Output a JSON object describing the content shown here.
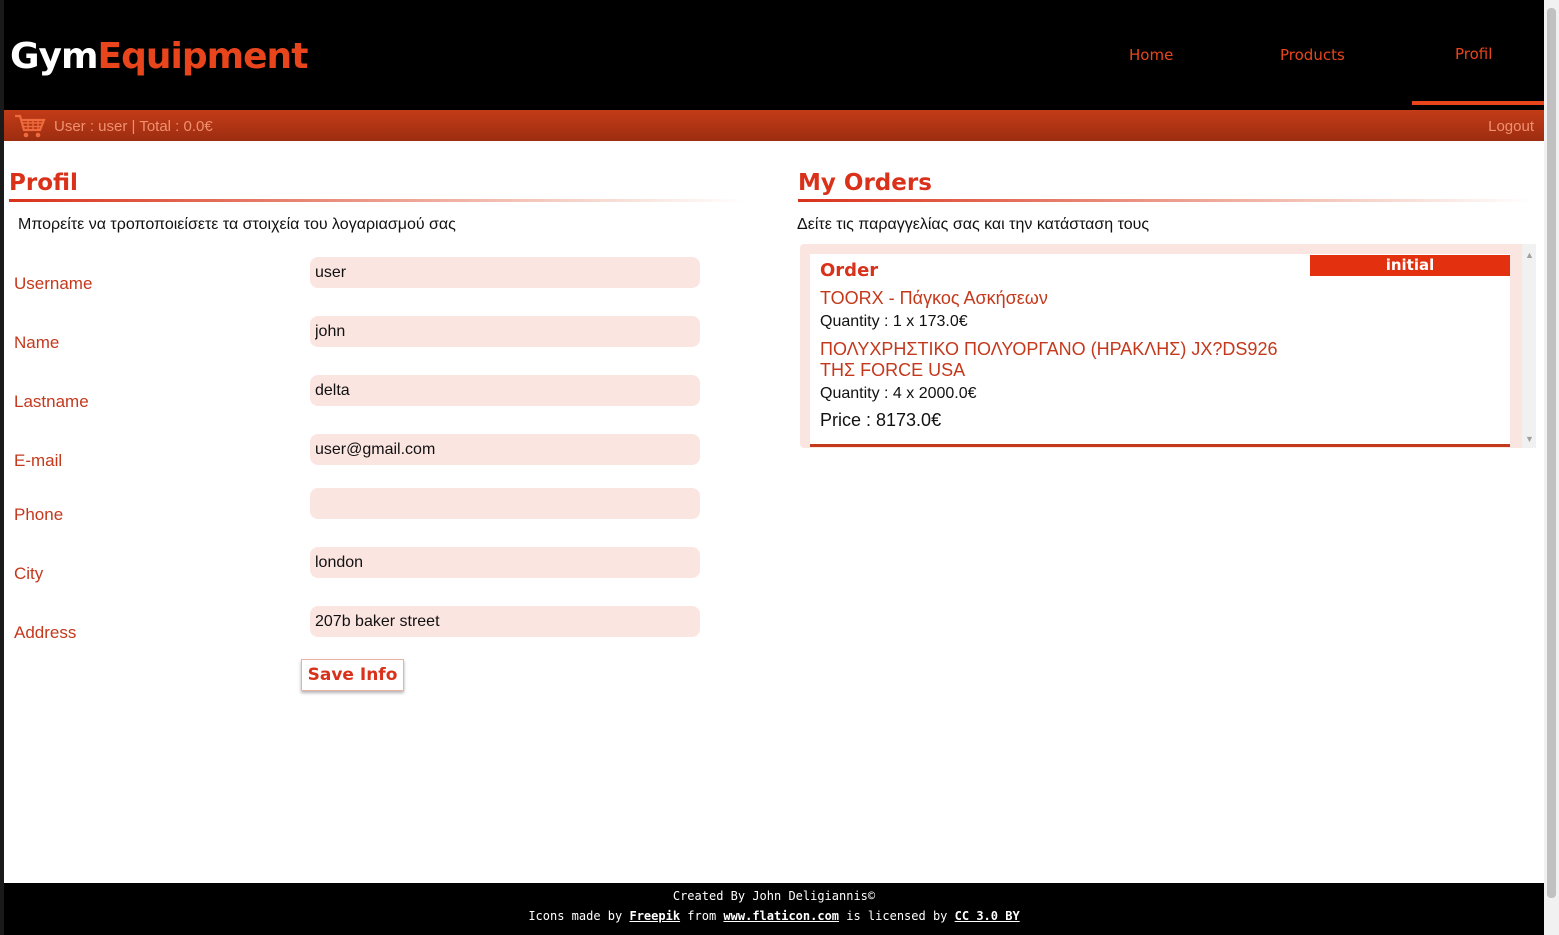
{
  "brand": {
    "part1": "Gym",
    "part2": "Equipment"
  },
  "nav": {
    "home": "Home",
    "products": "Products",
    "profil": "Profil"
  },
  "userbar": {
    "info": "User : user | Total : 0.0€",
    "logout": "Logout"
  },
  "profile": {
    "title": "Profil",
    "subtitle": "Μπορείτε να τροποποιείσετε τα στοιχεία του λογαριασμού σας",
    "fields": {
      "username": {
        "label": "Username",
        "value": "user"
      },
      "name": {
        "label": "Name",
        "value": "john"
      },
      "lastname": {
        "label": "Lastname",
        "value": "delta"
      },
      "email": {
        "label": "E-mail",
        "value": "user@gmail.com"
      },
      "phone": {
        "label": "Phone",
        "value": ""
      },
      "city": {
        "label": "City",
        "value": "london"
      },
      "address": {
        "label": "Address",
        "value": "207b baker street"
      }
    },
    "save_label": "Save Info"
  },
  "orders": {
    "title": "My Orders",
    "subtitle": "Δείτε τις παραγγελίας σας και την κατάσταση τους",
    "list": [
      {
        "title": "Order",
        "status": "initial",
        "items": [
          {
            "name": "TOORX - Πάγκος Ασκήσεων",
            "qty": "Quantity : 1 x 173.0€"
          },
          {
            "name": "ΠΟΛΥΧΡΗΣΤΙΚΟ ΠΟΛΥΟΡΓΑΝΟ (ΗΡΑΚΛΗΣ) JX?DS926 ΤΗΣ FORCE USA",
            "qty": "Quantity : 4 x 2000.0€"
          }
        ],
        "price": "Price : 8173.0€"
      }
    ]
  },
  "footer": {
    "created": "Created By John Deligiannis©",
    "icons_prefix": "Icons made by",
    "freepik": "Freepik",
    "from": "from",
    "flaticon": "www.flaticon.com",
    "licensed": "is licensed by",
    "license": "CC 3.0 BY"
  },
  "colors": {
    "accent": "#e8451c",
    "label": "#c4381c",
    "input_bg": "#fbe5e1",
    "header_bg": "#000000"
  }
}
